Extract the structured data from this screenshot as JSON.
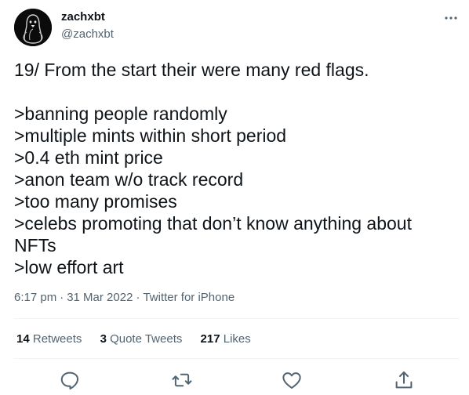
{
  "author": {
    "name": "zachxbt",
    "handle": "@zachxbt",
    "avatar_icon": "penguin-avatar-icon"
  },
  "tweet": {
    "text": "19/ From the start their were many red flags.\n\n>banning people randomly\n>multiple mints within short period\n>0.4 eth mint price\n>anon team w/o track record\n>too many promises\n>celebs promoting that don’t know anything about NFTs\n>low effort art",
    "time": "6:17 pm",
    "separator": "·",
    "date": "31 Mar 2022",
    "source": "Twitter for iPhone"
  },
  "stats": {
    "retweets": {
      "count": "14",
      "label": "Retweets"
    },
    "quote_tweets": {
      "count": "3",
      "label": "Quote Tweets"
    },
    "likes": {
      "count": "217",
      "label": "Likes"
    }
  },
  "actions": [
    "reply-icon",
    "retweet-icon",
    "like-icon",
    "share-icon"
  ],
  "colors": {
    "text": "#0f1419",
    "secondary": "#536471",
    "divider": "#eff3f4",
    "icon": "#536471"
  }
}
